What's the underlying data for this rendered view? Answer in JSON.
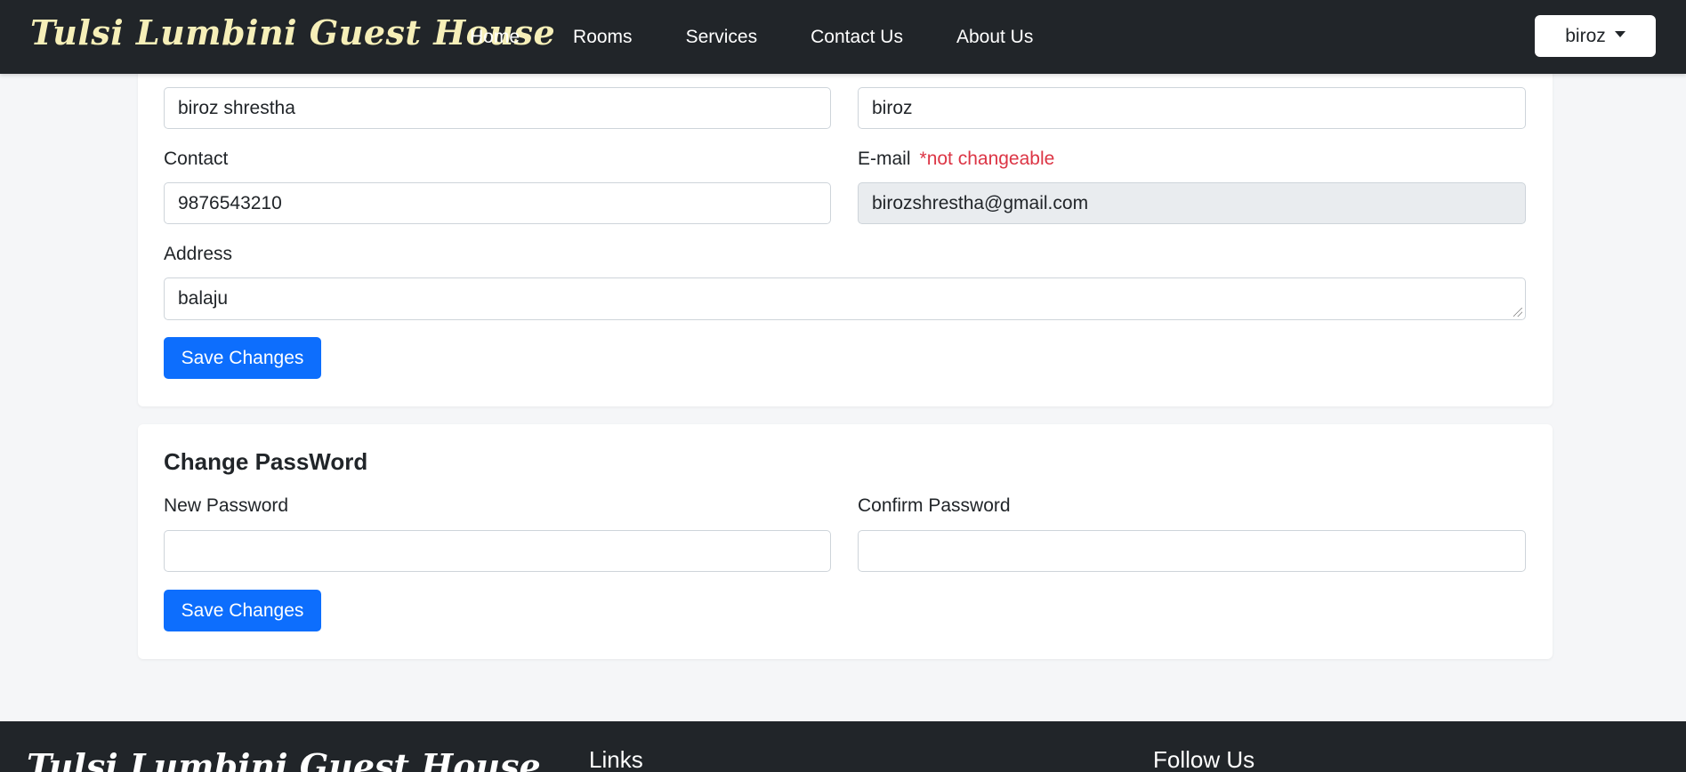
{
  "navbar": {
    "brand": "Tulsi Lumbini Guest House",
    "links": [
      "Home",
      "Rooms",
      "Services",
      "Contact Us",
      "About Us"
    ],
    "user": "biroz"
  },
  "profile_form": {
    "name_value": "biroz shrestha",
    "username_value": "biroz",
    "contact_label": "Contact",
    "contact_value": "9876543210",
    "email_label": "E-mail",
    "email_note": "*not changeable",
    "email_value": "birozshrestha@gmail.com",
    "address_label": "Address",
    "address_value": "balaju",
    "save_label": "Save Changes"
  },
  "password_form": {
    "title": "Change PassWord",
    "new_label": "New Password",
    "confirm_label": "Confirm Password",
    "new_value": "",
    "confirm_value": "",
    "save_label": "Save Changes"
  },
  "footer": {
    "brand": "Tulsi Lumbini Guest House",
    "links_heading": "Links",
    "follow_heading": "Follow Us"
  },
  "colors": {
    "navbar_bg": "#212529",
    "brand_color": "#f6efb8",
    "primary": "#0d6efd",
    "danger": "#dc3545"
  }
}
